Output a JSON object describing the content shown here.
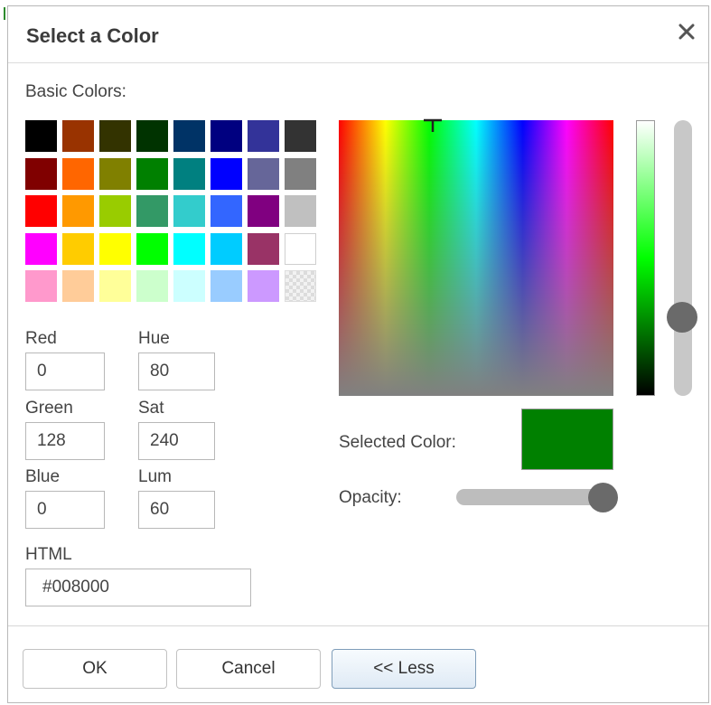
{
  "dialog": {
    "title": "Select a Color",
    "close_icon": "close-icon"
  },
  "basic_colors": {
    "label": "Basic Colors:",
    "swatches": [
      [
        "#000000",
        "#993300",
        "#333300",
        "#003300",
        "#003366",
        "#000080",
        "#333399",
        "#333333"
      ],
      [
        "#800000",
        "#ff6600",
        "#808000",
        "#008000",
        "#008080",
        "#0000ff",
        "#666699",
        "#808080"
      ],
      [
        "#ff0000",
        "#ff9900",
        "#99cc00",
        "#339966",
        "#33cccc",
        "#3366ff",
        "#800080",
        "#c0c0c0"
      ],
      [
        "#ff00ff",
        "#ffcc00",
        "#ffff00",
        "#00ff00",
        "#00ffff",
        "#00ccff",
        "#993366",
        "#ffffff"
      ],
      [
        "#ff99cc",
        "#ffcc99",
        "#ffff99",
        "#ccffcc",
        "#ccffff",
        "#99ccff",
        "#cc99ff",
        "transparent"
      ]
    ]
  },
  "fields": {
    "red": {
      "label": "Red",
      "value": "0"
    },
    "green": {
      "label": "Green",
      "value": "128"
    },
    "blue": {
      "label": "Blue",
      "value": "0"
    },
    "hue": {
      "label": "Hue",
      "value": "80"
    },
    "sat": {
      "label": "Sat",
      "value": "240"
    },
    "lum": {
      "label": "Lum",
      "value": "60"
    },
    "html": {
      "label": "HTML",
      "value": "#008000"
    }
  },
  "picker": {
    "selected_label": "Selected Color:",
    "selected_color": "#008000",
    "opacity_label": "Opacity:",
    "opacity_value": 1.0,
    "luminance_value": 0.28
  },
  "buttons": {
    "ok": "OK",
    "cancel": "Cancel",
    "less": "<< Less"
  }
}
